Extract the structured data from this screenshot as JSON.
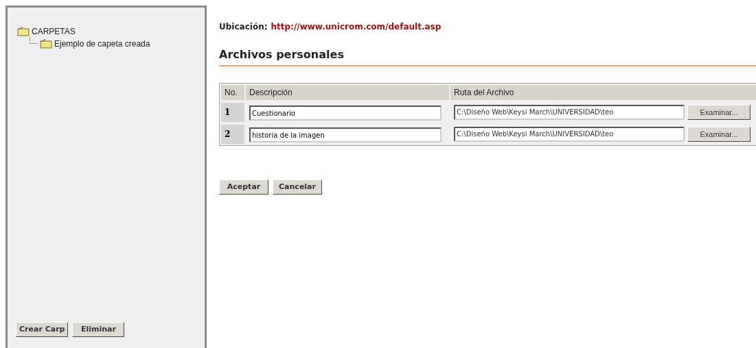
{
  "sidebar": {
    "tree": [
      {
        "label": "CARPETAS",
        "children": [
          {
            "label": "Ejemplo de capeta creada"
          }
        ]
      }
    ],
    "buttons": [
      "Crear Carp",
      "Eliminar"
    ]
  },
  "location": {
    "label": "Ubicación:",
    "url": "http://www.unicrom.com/default.asp"
  },
  "heading": "Archivos personales",
  "table": {
    "columns": [
      "No.",
      "Descripción",
      "Ruta del Archivo"
    ],
    "rows": [
      {
        "number": "1",
        "description": "Cuestionario",
        "path": "C:\\Diseño Web\\Keysi March\\UNIVERSIDAD\\teo",
        "browse": "Examinar..."
      },
      {
        "number": "2",
        "description": "historia de la imagen",
        "path": "C:\\Diseño Web\\Keysi March\\UNIVERSIDAD\\teo",
        "browse": "Examinar..."
      }
    ]
  },
  "buttons": [
    "Aceptar",
    "Cancelar"
  ]
}
